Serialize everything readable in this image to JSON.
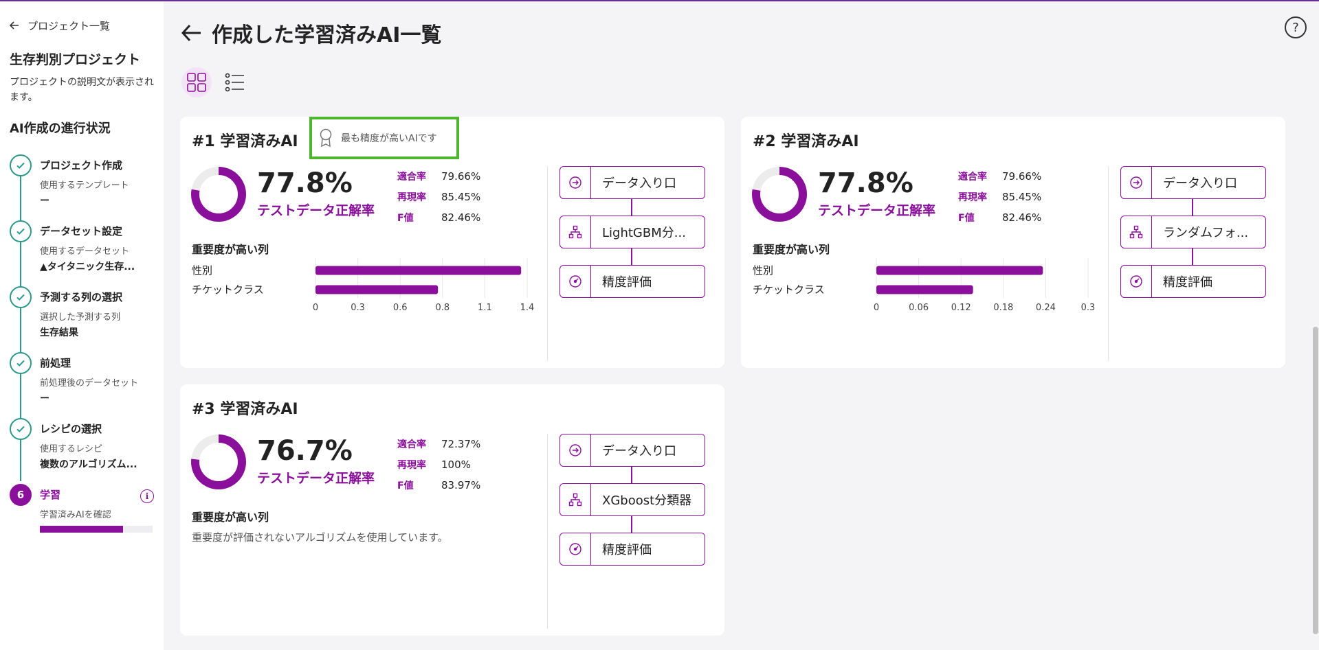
{
  "sidebar": {
    "back_label": "プロジェクト一覧",
    "project_title": "生存判別プロジェクト",
    "project_desc": "プロジェクトの説明文が表示されます。",
    "progress_title": "AI作成の進行状況",
    "steps": [
      {
        "name": "プロジェクト作成",
        "sub": "使用するテンプレート",
        "value": "ー"
      },
      {
        "name": "データセット設定",
        "sub": "使用するデータセット",
        "value": "▲タイタニック生存..."
      },
      {
        "name": "予測する列の選択",
        "sub": "選択した予測する列",
        "value": "生存結果"
      },
      {
        "name": "前処理",
        "sub": "前処理後のデータセット",
        "value": "ー"
      },
      {
        "name": "レシピの選択",
        "sub": "使用するレシピ",
        "value": "複数のアルゴリズム..."
      }
    ],
    "current_step": {
      "number": "6",
      "name": "学習",
      "sub": "学習済みAIを確認",
      "progress": 0.74
    }
  },
  "header": {
    "title": "作成した学習済みAI一覧"
  },
  "colors": {
    "accent": "#8a0f9a",
    "teal": "#2a9a8a",
    "badge_border": "#4fb52f"
  },
  "cards": [
    {
      "title": "#1 学習済みAI",
      "badge": "最も精度が高いAIです",
      "accuracy": "77.8%",
      "accuracy_fraction": 0.778,
      "accuracy_label": "テストデータ正解率",
      "metrics": [
        {
          "label": "適合率",
          "value": "79.66%"
        },
        {
          "label": "再現率",
          "value": "85.45%"
        },
        {
          "label": "F値",
          "value": "82.46%"
        }
      ],
      "importance_title": "重要度が高い列",
      "pipeline": [
        {
          "icon": "enter-icon",
          "label": "データ入り口"
        },
        {
          "icon": "tree-icon",
          "label": "LightGBM分..."
        },
        {
          "icon": "gauge-icon",
          "label": "精度評価"
        }
      ]
    },
    {
      "title": "#2 学習済みAI",
      "accuracy": "77.8%",
      "accuracy_fraction": 0.778,
      "accuracy_label": "テストデータ正解率",
      "metrics": [
        {
          "label": "適合率",
          "value": "79.66%"
        },
        {
          "label": "再現率",
          "value": "85.45%"
        },
        {
          "label": "F値",
          "value": "82.46%"
        }
      ],
      "importance_title": "重要度が高い列",
      "pipeline": [
        {
          "icon": "enter-icon",
          "label": "データ入り口"
        },
        {
          "icon": "tree-icon",
          "label": "ランダムフォ..."
        },
        {
          "icon": "gauge-icon",
          "label": "精度評価"
        }
      ]
    },
    {
      "title": "#3 学習済みAI",
      "accuracy": "76.7%",
      "accuracy_fraction": 0.767,
      "accuracy_label": "テストデータ正解率",
      "metrics": [
        {
          "label": "適合率",
          "value": "72.37%"
        },
        {
          "label": "再現率",
          "value": "100%"
        },
        {
          "label": "F値",
          "value": "83.97%"
        }
      ],
      "importance_title": "重要度が高い列",
      "importance_note": "重要度が評価されないアルゴリズムを使用しています。",
      "pipeline": [
        {
          "icon": "enter-icon",
          "label": "データ入り口"
        },
        {
          "icon": "tree-icon",
          "label": "XGboost分類器"
        },
        {
          "icon": "gauge-icon",
          "label": "精度評価"
        }
      ]
    }
  ],
  "chart_data": [
    {
      "type": "bar",
      "orientation": "horizontal",
      "categories": [
        "性別",
        "チケットクラス"
      ],
      "values": [
        1.36,
        0.81
      ],
      "xticks": [
        "0",
        "0.3",
        "0.6",
        "0.8",
        "1.1",
        "1.4"
      ],
      "xlim": [
        0,
        1.4
      ],
      "grid": true
    },
    {
      "type": "bar",
      "orientation": "horizontal",
      "categories": [
        "性別",
        "チケットクラス"
      ],
      "values": [
        0.236,
        0.137
      ],
      "xticks": [
        "0",
        "0.06",
        "0.12",
        "0.18",
        "0.24",
        "0.3"
      ],
      "xlim": [
        0,
        0.3
      ],
      "grid": true
    }
  ]
}
